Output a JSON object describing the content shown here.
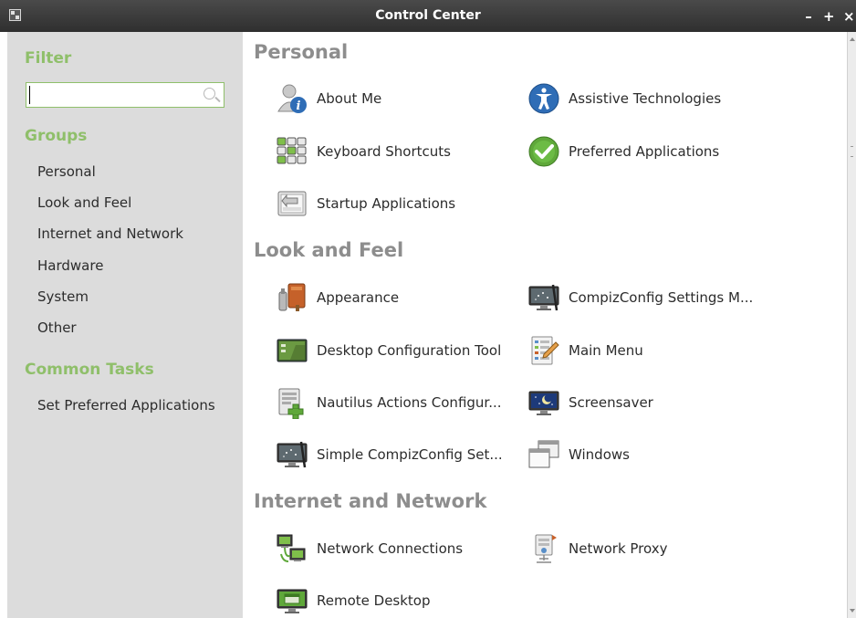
{
  "window": {
    "title": "Control Center",
    "controls": {
      "minimize": "–",
      "maximize": "+",
      "close": "×"
    }
  },
  "sidebar": {
    "filter_title": "Filter",
    "search": {
      "value": "",
      "placeholder": ""
    },
    "groups_title": "Groups",
    "groups": [
      "Personal",
      "Look and Feel",
      "Internet and Network",
      "Hardware",
      "System",
      "Other"
    ],
    "common_tasks_title": "Common Tasks",
    "common_tasks": [
      "Set Preferred Applications"
    ]
  },
  "main": {
    "categories": [
      {
        "title": "Personal",
        "items": [
          {
            "label": "About Me",
            "icon": "about-me-icon"
          },
          {
            "label": "Assistive Technologies",
            "icon": "accessibility-icon"
          },
          {
            "label": "Keyboard Shortcuts",
            "icon": "keyboard-shortcuts-icon"
          },
          {
            "label": "Preferred Applications",
            "icon": "preferred-applications-icon"
          },
          {
            "label": "Startup Applications",
            "icon": "startup-applications-icon"
          }
        ]
      },
      {
        "title": "Look and Feel",
        "items": [
          {
            "label": "Appearance",
            "icon": "appearance-icon"
          },
          {
            "label": "CompizConfig Settings M...",
            "icon": "compizconfig-icon"
          },
          {
            "label": "Desktop Configuration Tool",
            "icon": "desktop-configuration-icon"
          },
          {
            "label": "Main Menu",
            "icon": "main-menu-icon"
          },
          {
            "label": "Nautilus Actions Configur...",
            "icon": "nautilus-actions-icon"
          },
          {
            "label": "Screensaver",
            "icon": "screensaver-icon"
          },
          {
            "label": "Simple CompizConfig Set...",
            "icon": "simple-compizconfig-icon"
          },
          {
            "label": "Windows",
            "icon": "windows-icon"
          }
        ]
      },
      {
        "title": "Internet and Network",
        "items": [
          {
            "label": "Network Connections",
            "icon": "network-connections-icon"
          },
          {
            "label": "Network Proxy",
            "icon": "network-proxy-icon"
          },
          {
            "label": "Remote Desktop",
            "icon": "remote-desktop-icon"
          }
        ]
      }
    ]
  },
  "colors": {
    "accent_green": "#8fbf6a",
    "sidebar_bg": "#dcdcdc",
    "category_gray": "#8d8d8d",
    "titlebar_bg": "#3a3a3a"
  }
}
